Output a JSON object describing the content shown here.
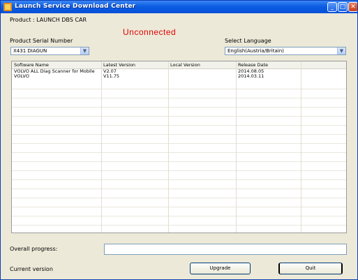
{
  "window": {
    "title": "Launch Service Download Center",
    "controls": {
      "minimize": "_",
      "maximize": "□",
      "close": "✕"
    }
  },
  "header": {
    "serial_line": "Product : LAUNCH DBS CAR",
    "status": "Unconnected",
    "product_serial_label": "Product Serial Number",
    "product_serial_value": "X431 DIAGUN",
    "language_label": "Select Language",
    "language_value": "English(Austria/Britain)"
  },
  "table": {
    "columns": [
      "Software Name",
      "Latest Version",
      "Local Version",
      "Release Date"
    ],
    "rows": [
      [
        "VOLVO ALL Diag Scanner for Mobile",
        "V2.07",
        "",
        "2014.08.05"
      ],
      [
        "VOLVO",
        "V11.75",
        "",
        "2014.03.11"
      ]
    ],
    "empty_rows": 17
  },
  "footer": {
    "progress_label": "Overall progress:",
    "progress_value": "",
    "info_text": "Current version",
    "upgrade_label": "Upgrade",
    "quit_label": "Quit"
  },
  "icons": [
    "app-icon",
    "minimize-icon",
    "maximize-icon",
    "close-icon",
    "chevron-down-icon"
  ]
}
